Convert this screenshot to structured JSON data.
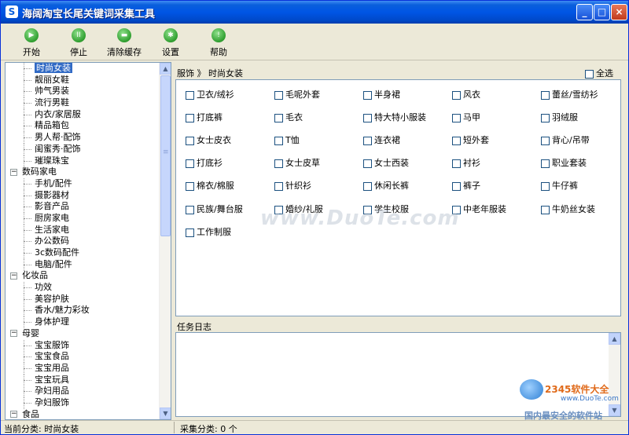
{
  "window": {
    "title": "海阔淘宝长尾关键词采集工具"
  },
  "toolbar": [
    {
      "label": "开始",
      "icon": "play-icon"
    },
    {
      "label": "停止",
      "icon": "pause-icon"
    },
    {
      "label": "清除缓存",
      "icon": "clear-cache-icon"
    },
    {
      "label": "设置",
      "icon": "gear-icon"
    },
    {
      "label": "帮助",
      "icon": "help-icon"
    }
  ],
  "tree": {
    "items": [
      {
        "text": "时尚女装",
        "kind": "leaf",
        "selected": true
      },
      {
        "text": "靓丽女鞋",
        "kind": "leaf"
      },
      {
        "text": "帅气男装",
        "kind": "leaf"
      },
      {
        "text": "流行男鞋",
        "kind": "leaf"
      },
      {
        "text": "内衣/家居服",
        "kind": "leaf"
      },
      {
        "text": "精品箱包",
        "kind": "leaf"
      },
      {
        "text": "男人帮·配饰",
        "kind": "leaf"
      },
      {
        "text": "闺蜜秀·配饰",
        "kind": "leaf"
      },
      {
        "text": "璀璨珠宝",
        "kind": "leaf"
      },
      {
        "text": "数码家电",
        "kind": "cat"
      },
      {
        "text": "手机/配件",
        "kind": "leaf"
      },
      {
        "text": "摄影器材",
        "kind": "leaf"
      },
      {
        "text": "影音产品",
        "kind": "leaf"
      },
      {
        "text": "厨房家电",
        "kind": "leaf"
      },
      {
        "text": "生活家电",
        "kind": "leaf"
      },
      {
        "text": "办公数码",
        "kind": "leaf"
      },
      {
        "text": "3c数码配件",
        "kind": "leaf"
      },
      {
        "text": "电脑/配件",
        "kind": "leaf"
      },
      {
        "text": "化妆品",
        "kind": "cat"
      },
      {
        "text": "功效",
        "kind": "leaf"
      },
      {
        "text": "美容护肤",
        "kind": "leaf"
      },
      {
        "text": "香水/魅力彩妆",
        "kind": "leaf"
      },
      {
        "text": "身体护理",
        "kind": "leaf"
      },
      {
        "text": "母婴",
        "kind": "cat"
      },
      {
        "text": "宝宝服饰",
        "kind": "leaf"
      },
      {
        "text": "宝宝食品",
        "kind": "leaf"
      },
      {
        "text": "宝宝用品",
        "kind": "leaf"
      },
      {
        "text": "宝宝玩具",
        "kind": "leaf"
      },
      {
        "text": "孕妇用品",
        "kind": "leaf"
      },
      {
        "text": "孕妇服饰",
        "kind": "leaf"
      },
      {
        "text": "食品",
        "kind": "cat"
      }
    ]
  },
  "breadcrumb": "服饰 》 时尚女装",
  "select_all": "全选",
  "options": [
    "卫衣/绒衫",
    "毛呢外套",
    "半身裙",
    "风衣",
    "蕾丝/雪纺衫",
    "打底裤",
    "毛衣",
    "特大特小服装",
    "马甲",
    "羽绒服",
    "女士皮衣",
    "T恤",
    "连衣裙",
    "短外套",
    "背心/吊带",
    "打底衫",
    "女士皮草",
    "女士西装",
    "衬衫",
    "职业套装",
    "棉衣/棉服",
    "针织衫",
    "休闲长裤",
    "裤子",
    "牛仔裤",
    "民族/舞台服",
    "婚纱/礼服",
    "学生校服",
    "中老年服装",
    "牛奶丝女装",
    "工作制服"
  ],
  "log": {
    "label": "任务日志"
  },
  "status": {
    "current": "当前分类: 时尚女装",
    "collect": "采集分类: 0 个"
  },
  "watermark": "www.DuoTe.com",
  "brand": {
    "name": "2345软件大全",
    "url": "www.DuoTe.com",
    "tagline": "国内最安全的软件站"
  }
}
